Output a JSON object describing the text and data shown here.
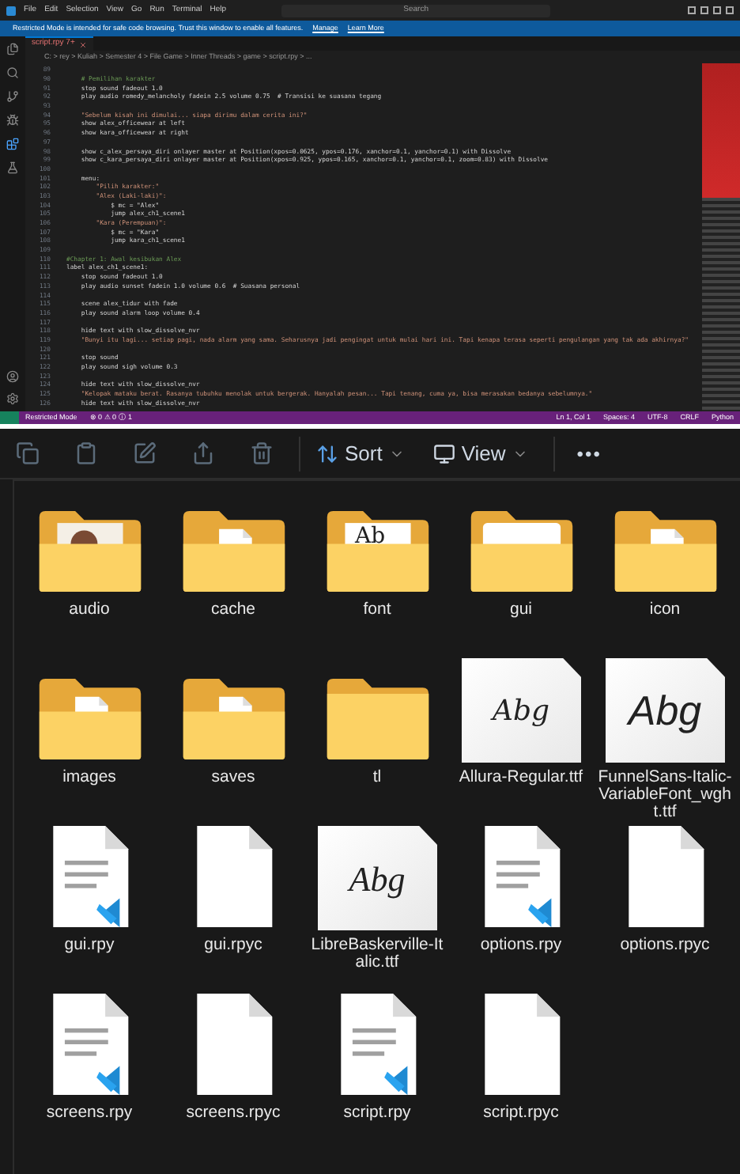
{
  "editor": {
    "menu": [
      "File",
      "Edit",
      "Selection",
      "View",
      "Go",
      "Run",
      "Terminal",
      "Help"
    ],
    "search": {
      "placeholder": "Search"
    },
    "banner": {
      "message": "Restricted Mode is intended for safe code browsing. Trust this window to enable all features.",
      "links": [
        "Manage",
        "Learn More"
      ]
    },
    "tabs": [
      {
        "label": "script.rpy 7+",
        "selected": true,
        "modified": true
      }
    ],
    "breadcrumb": "C: > rey > Kuliah > Semester 4 > File Game > Inner Threads > game > script.rpy > ...",
    "lines": [
      {
        "number": "89"
      },
      {
        "number": "90",
        "kind": "comment",
        "text": "    # Pemilihan karakter"
      },
      {
        "number": "91",
        "kind": "code",
        "text": "    stop sound fadeout 1.0"
      },
      {
        "number": "92",
        "kind": "code",
        "text": "    play audio romedy_melancholy fadein 2.5 volume 0.75  # Transisi ke suasana tegang"
      },
      {
        "number": "93"
      },
      {
        "number": "94",
        "kind": "string",
        "text": "    \"Sebelum kisah ini dimulai... siapa dirimu dalam cerita ini?\""
      },
      {
        "number": "95",
        "kind": "code",
        "text": "    show alex_officewear at left"
      },
      {
        "number": "96",
        "kind": "code",
        "text": "    show kara_officewear at right"
      },
      {
        "number": "97"
      },
      {
        "number": "98",
        "kind": "code",
        "text": "    show c_alex_persaya_diri onlayer master at Position(xpos=0.0625, ypos=0.176, xanchor=0.1, yanchor=0.1) with Dissolve"
      },
      {
        "number": "99",
        "kind": "code",
        "text": "    show c_kara_persaya_diri onlayer master at Position(xpos=0.925, ypos=0.165, xanchor=0.1, yanchor=0.1, zoom=0.83) with Dissolve"
      },
      {
        "number": "100"
      },
      {
        "number": "101",
        "kind": "code",
        "text": "    menu:"
      },
      {
        "number": "102",
        "kind": "string",
        "text": "        \"Pilih karakter:\""
      },
      {
        "number": "103",
        "kind": "string",
        "text": "        \"Alex (Laki-laki)\":"
      },
      {
        "number": "104",
        "kind": "code",
        "text": "            $ mc = \"Alex\""
      },
      {
        "number": "105",
        "kind": "code",
        "text": "            jump alex_ch1_scene1"
      },
      {
        "number": "106",
        "kind": "string",
        "text": "        \"Kara (Perempuan)\":"
      },
      {
        "number": "107",
        "kind": "code",
        "text": "            $ mc = \"Kara\""
      },
      {
        "number": "108",
        "kind": "code",
        "text": "            jump kara_ch1_scene1"
      },
      {
        "number": "109"
      },
      {
        "number": "110",
        "kind": "comment",
        "text": "#Chapter 1: Awal kesibukan Alex"
      },
      {
        "number": "111",
        "kind": "code",
        "text": "label alex_ch1_scene1:"
      },
      {
        "number": "112",
        "kind": "code",
        "text": "    stop sound fadeout 1.0"
      },
      {
        "number": "113",
        "kind": "code",
        "text": "    play audio sunset fadein 1.0 volume 0.6  # Suasana personal"
      },
      {
        "number": "114"
      },
      {
        "number": "115",
        "kind": "code",
        "text": "    scene alex_tidur with fade"
      },
      {
        "number": "116",
        "kind": "code",
        "text": "    play sound alarm loop volume 0.4"
      },
      {
        "number": "117"
      },
      {
        "number": "118",
        "kind": "code",
        "text": "    hide text with slow_dissolve_nvr"
      },
      {
        "number": "119",
        "kind": "string",
        "text": "    \"Bunyi itu lagi... setiap pagi, nada alarm yang sama. Seharusnya jadi pengingat untuk mulai hari ini. Tapi kenapa terasa seperti pengulangan yang tak ada akhirnya?\""
      },
      {
        "number": "120"
      },
      {
        "number": "121",
        "kind": "code",
        "text": "    stop sound"
      },
      {
        "number": "122",
        "kind": "code",
        "text": "    play sound sigh volume 0.3"
      },
      {
        "number": "123"
      },
      {
        "number": "124",
        "kind": "code",
        "text": "    hide text with slow_dissolve_nvr"
      },
      {
        "number": "125",
        "kind": "string",
        "text": "    \"Kelopak mataku berat. Rasanya tubuhku menolak untuk bergerak. Hanyalah pesan... Tapi tenang, cuma ya, bisa merasakan bedanya sebelumnya.\""
      },
      {
        "number": "126",
        "kind": "code",
        "text": "    hide text with slow_dissolve_nvr"
      }
    ],
    "status_left": [
      "Restricted Mode",
      "⊗ 0 ⚠ 0 ⓘ 1"
    ],
    "status_right": [
      "Ln 1, Col 1",
      "Spaces: 4",
      "UTF-8",
      "CRLF",
      "Python"
    ]
  },
  "explorer": {
    "toolbar": {
      "sort": "Sort",
      "view": "View",
      "more": "•••"
    },
    "items": [
      {
        "name": "audio",
        "kind": "photofolder"
      },
      {
        "name": "cache",
        "kind": "docfolder"
      },
      {
        "name": "font",
        "kind": "samplefolder",
        "preview": "Ab"
      },
      {
        "name": "gui",
        "kind": "paperfolder"
      },
      {
        "name": "icon",
        "kind": "docfolder"
      },
      {
        "name": "images",
        "kind": "docfolder"
      },
      {
        "name": "saves",
        "kind": "docfolder"
      },
      {
        "name": "tl",
        "kind": "folder"
      },
      {
        "name": "Allura-Regular.ttf",
        "kind": "scriptfont",
        "preview": "Abg"
      },
      {
        "name": "FunnelSans-Italic-VariableFont_wght.ttf",
        "kind": "sansfont",
        "preview": "Abg"
      },
      {
        "name": "gui.rpy",
        "kind": "code"
      },
      {
        "name": "gui.rpyc",
        "kind": "blank"
      },
      {
        "name": "LibreBaskerville-Italic.ttf",
        "kind": "seriffont",
        "preview": "Abg"
      },
      {
        "name": "options.rpy",
        "kind": "code"
      },
      {
        "name": "options.rpyc",
        "kind": "blank"
      },
      {
        "name": "screens.rpy",
        "kind": "code"
      },
      {
        "name": "screens.rpyc",
        "kind": "blank"
      },
      {
        "name": "script.rpy",
        "kind": "code"
      },
      {
        "name": "script.rpyc",
        "kind": "blank"
      }
    ]
  }
}
